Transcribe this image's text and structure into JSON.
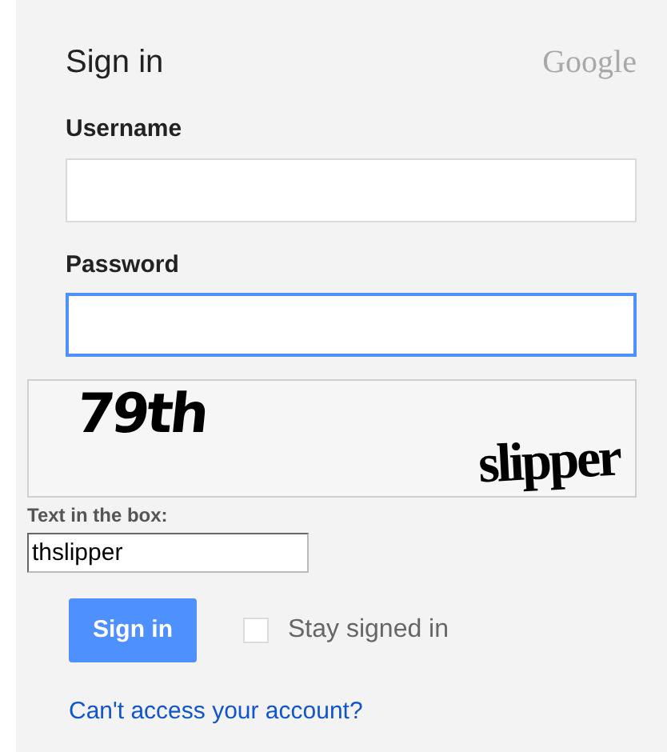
{
  "header": {
    "title": "Sign in",
    "logo": "Google"
  },
  "fields": [
    {
      "label": "Username",
      "focused": false
    },
    {
      "label": "Password",
      "focused": true
    }
  ],
  "captcha": {
    "words": [
      "79th",
      "slipper"
    ],
    "label": "Text in the box:",
    "value": "thslipper"
  },
  "sign_in_button": "Sign in",
  "stay_signed_in": {
    "label": "Stay signed in",
    "checked": false
  },
  "help_link": "Can't access your account?"
}
